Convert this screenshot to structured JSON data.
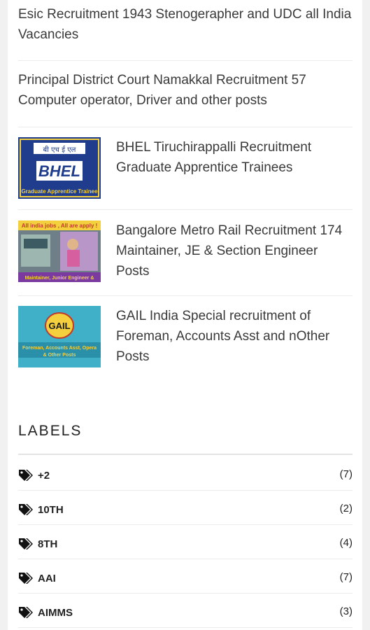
{
  "recent_posts": [
    {
      "title": "Esic Recruitment 1943 Stenogerapher and UDC all India Vacancies"
    },
    {
      "title": "Principal District Court Namakkal Recruitment 57 Computer operator, Driver and other posts"
    }
  ],
  "thumb_posts": [
    {
      "title": "BHEL Tiruchirappalli Recruitment Graduate Apprentice Trainees",
      "thumb_text": [
        "बी एच ई एल",
        "BHEL",
        "Graduate Apprentice Trainee"
      ],
      "thumb_color": "#1f3d8c"
    },
    {
      "title": "Bangalore Metro Rail Recruitment 174 Maintainer, JE & Section Engineer Posts",
      "thumb_text": [
        "All india jobs , All are apply !",
        "Maintainer, Junior Engineer &"
      ],
      "thumb_color": "#7a3aa0"
    },
    {
      "title": "GAIL India Special recruitment of Foreman, Accounts Asst and nOther Posts",
      "thumb_text": [
        "GAIL",
        "Foreman, Accounts Asst, Opera",
        "& Other Posts"
      ],
      "thumb_color": "#3fb0c8"
    }
  ],
  "labels_section": {
    "heading": "LABELS",
    "items": [
      {
        "name": "+2",
        "count": "(7)"
      },
      {
        "name": "10TH",
        "count": "(2)"
      },
      {
        "name": "8TH",
        "count": "(4)"
      },
      {
        "name": "AAI",
        "count": "(7)"
      },
      {
        "name": "AIMMS",
        "count": "(3)"
      }
    ]
  },
  "icons": {
    "label": "tag-icon"
  }
}
